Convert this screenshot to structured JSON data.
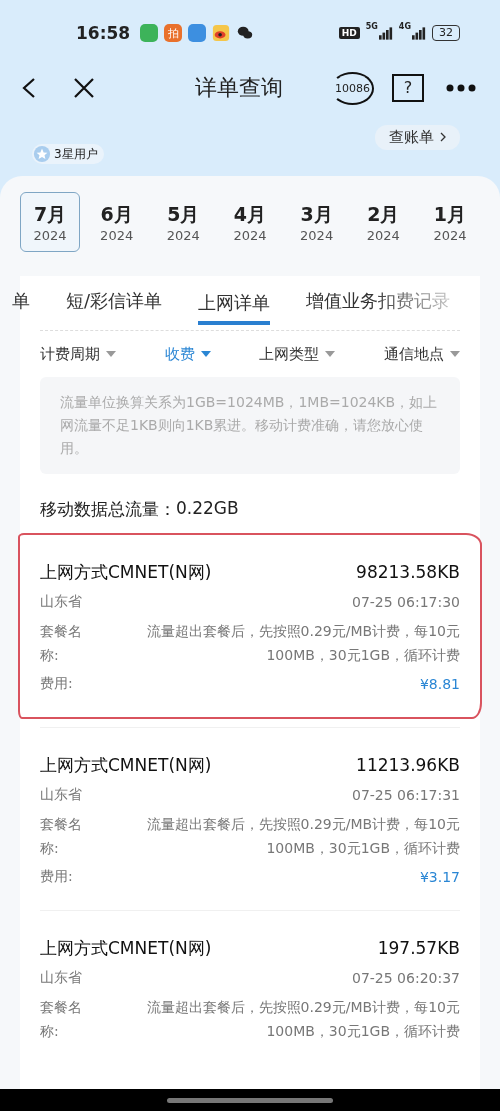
{
  "status_bar": {
    "time": "16:58",
    "app_badge": "拍",
    "hd": "HD",
    "networks": [
      "5G",
      "4G"
    ],
    "battery": "32"
  },
  "header": {
    "title": "详单查询",
    "hotline": "10086",
    "help": "?"
  },
  "account": {
    "user_level": "3星用户",
    "bill_button": "查账单"
  },
  "months": [
    {
      "month": "7月",
      "year": "2024",
      "selected": true
    },
    {
      "month": "6月",
      "year": "2024",
      "selected": false
    },
    {
      "month": "5月",
      "year": "2024",
      "selected": false
    },
    {
      "month": "4月",
      "year": "2024",
      "selected": false
    },
    {
      "month": "3月",
      "year": "2024",
      "selected": false
    },
    {
      "month": "2月",
      "year": "2024",
      "selected": false
    },
    {
      "month": "1月",
      "year": "2024",
      "selected": false
    }
  ],
  "tabs": [
    {
      "label": "单",
      "selected": false
    },
    {
      "label": "短/彩信详单",
      "selected": false
    },
    {
      "label": "上网详单",
      "selected": true
    },
    {
      "label": "增值业务扣费记录",
      "selected": false
    }
  ],
  "filters": [
    {
      "label": "计费周期",
      "selected": false
    },
    {
      "label": "收费",
      "selected": true
    },
    {
      "label": "上网类型",
      "selected": false
    },
    {
      "label": "通信地点",
      "selected": false
    }
  ],
  "notice": "流量单位换算关系为1GB=1024MB，1MB=1024KB，如上网流量不足1KB则向1KB累进。移动计费准确，请您放心使用。",
  "total": {
    "label": "移动数据总流量：",
    "value": "0.22GB"
  },
  "records": [
    {
      "title": "上网方式CMNET(N网)",
      "usage": "98213.58KB",
      "location": "山东省",
      "time": "07-25 06:17:30",
      "package_label": "套餐名称:",
      "package": "流量超出套餐后，先按照0.29元/MB计费，每10元100MB，30元1GB，循环计费",
      "fee_label": "费用:",
      "fee": "¥8.81",
      "highlighted": true
    },
    {
      "title": "上网方式CMNET(N网)",
      "usage": "11213.96KB",
      "location": "山东省",
      "time": "07-25 06:17:31",
      "package_label": "套餐名称:",
      "package": "流量超出套餐后，先按照0.29元/MB计费，每10元100MB，30元1GB，循环计费",
      "fee_label": "费用:",
      "fee": "¥3.17",
      "highlighted": false
    },
    {
      "title": "上网方式CMNET(N网)",
      "usage": "197.57KB",
      "location": "山东省",
      "time": "07-25 06:20:37",
      "package_label": "套餐名称:",
      "package": "流量超出套餐后，先按照0.29元/MB计费，每10元100MB，30元1GB，循环计费",
      "highlighted": false
    }
  ]
}
